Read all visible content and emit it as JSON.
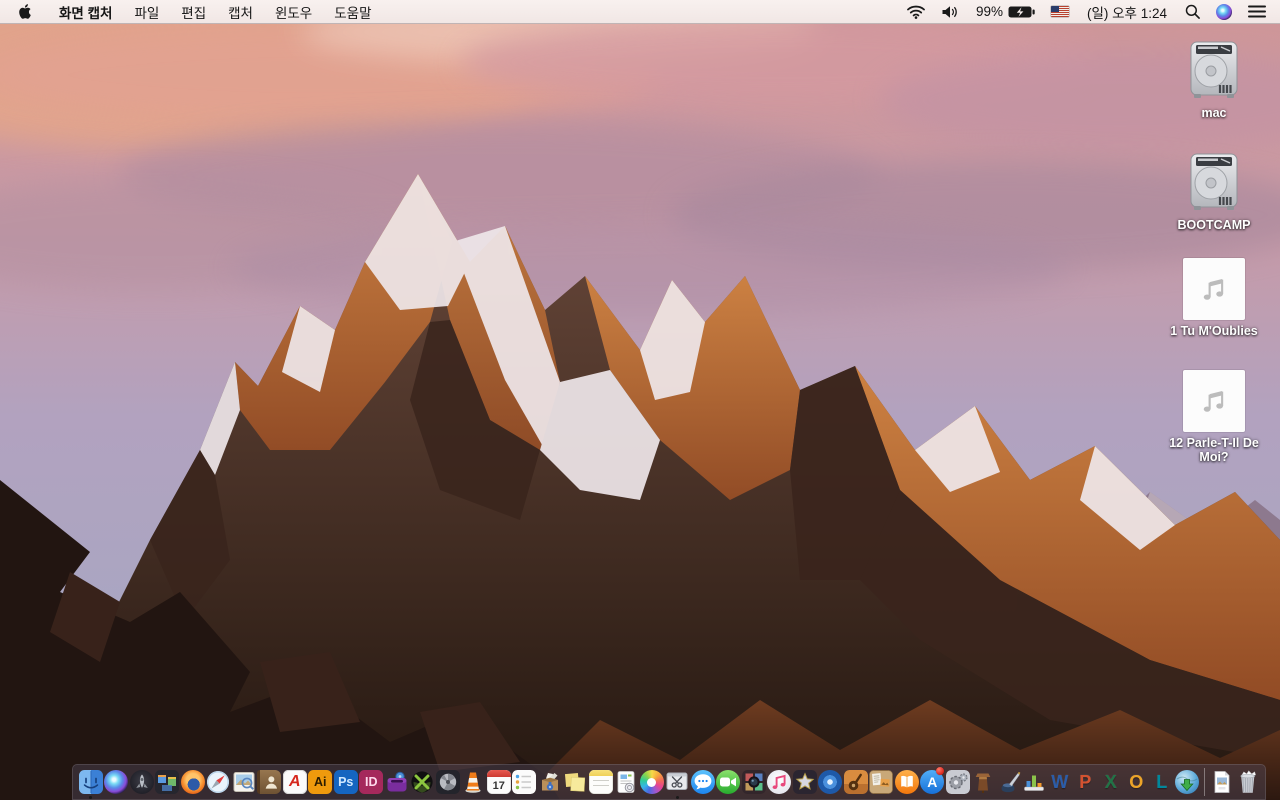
{
  "menubar": {
    "app_name": "화면 캡처",
    "menus": [
      {
        "label": "파일"
      },
      {
        "label": "편집"
      },
      {
        "label": "캡처"
      },
      {
        "label": "윈도우"
      },
      {
        "label": "도움말"
      }
    ],
    "status": {
      "battery_percent": "99%",
      "clock": "(일) 오후 1:24",
      "icons": [
        "wifi",
        "volume",
        "battery-charging",
        "us-flag-input-source",
        "spotlight-search",
        "siri",
        "notification-center"
      ]
    }
  },
  "desktop": {
    "icons": [
      {
        "label": "mac",
        "type": "hard-drive"
      },
      {
        "label": "BOOTCAMP",
        "type": "hard-drive"
      },
      {
        "label": "1 Tu M'Oublies",
        "type": "audio-file"
      },
      {
        "label": "12 Parle-T-Il De Moi?",
        "type": "audio-file"
      }
    ]
  },
  "dock": {
    "items": [
      {
        "icon": "finder",
        "running": true
      },
      {
        "icon": "siri"
      },
      {
        "icon": "launchpad"
      },
      {
        "icon": "mission-control"
      },
      {
        "icon": "firefox"
      },
      {
        "icon": "safari"
      },
      {
        "icon": "preview"
      },
      {
        "icon": "contacts"
      },
      {
        "icon": "acrobat-reader"
      },
      {
        "icon": "illustrator"
      },
      {
        "icon": "photoshop"
      },
      {
        "icon": "indesign"
      },
      {
        "icon": "toast-titanium"
      },
      {
        "icon": "x-media-player"
      },
      {
        "icon": "fan-control"
      },
      {
        "icon": "vlc"
      },
      {
        "icon": "calendar"
      },
      {
        "icon": "reminders"
      },
      {
        "icon": "stuffit-expander"
      },
      {
        "icon": "stickies"
      },
      {
        "icon": "notes"
      },
      {
        "icon": "installer"
      },
      {
        "icon": "photos"
      },
      {
        "icon": "grab-screen-capture",
        "running": true
      },
      {
        "icon": "messages"
      },
      {
        "icon": "facetime"
      },
      {
        "icon": "photo-booth"
      },
      {
        "icon": "itunes"
      },
      {
        "icon": "imovie"
      },
      {
        "icon": "dvd-player"
      },
      {
        "icon": "garageband"
      },
      {
        "icon": "collage-board"
      },
      {
        "icon": "ibooks"
      },
      {
        "icon": "app-store",
        "badge": true
      },
      {
        "icon": "system-preferences"
      },
      {
        "icon": "keynote"
      },
      {
        "icon": "pages"
      },
      {
        "icon": "numbers"
      },
      {
        "icon": "word"
      },
      {
        "icon": "powerpoint"
      },
      {
        "icon": "excel"
      },
      {
        "icon": "outlook"
      },
      {
        "icon": "lync"
      },
      {
        "icon": "globe-downloader"
      },
      {
        "separator": true
      },
      {
        "icon": "document-file"
      },
      {
        "icon": "trash-full"
      }
    ],
    "calendar_day": "17"
  }
}
